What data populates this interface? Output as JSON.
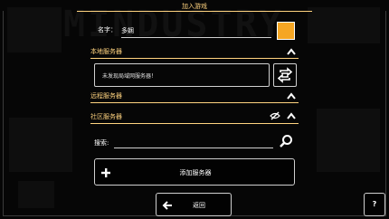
{
  "background": {
    "logo_text": "MINDUSTRY"
  },
  "dialog": {
    "title": "加入游戏"
  },
  "player": {
    "name_label": "名字：",
    "name_value": "多娴",
    "color": "#f5a623"
  },
  "sections": {
    "local": {
      "label": "本地服务器",
      "empty_message": "未发现局域网服务器！"
    },
    "remote": {
      "label": "远程服务器"
    },
    "community": {
      "label": "社区服务器"
    }
  },
  "search": {
    "label": "搜索:",
    "value": ""
  },
  "buttons": {
    "add_server": "添加服务器",
    "back": "返回",
    "help": "?"
  },
  "icons": {
    "collapse": "chevron-up-icon",
    "refresh": "refresh-icon",
    "hide": "eye-off-icon",
    "search": "search-icon",
    "add": "plus-icon",
    "back": "arrow-left-icon"
  },
  "colors": {
    "accent": "#ffd37f",
    "background": "#0c0c0c"
  }
}
